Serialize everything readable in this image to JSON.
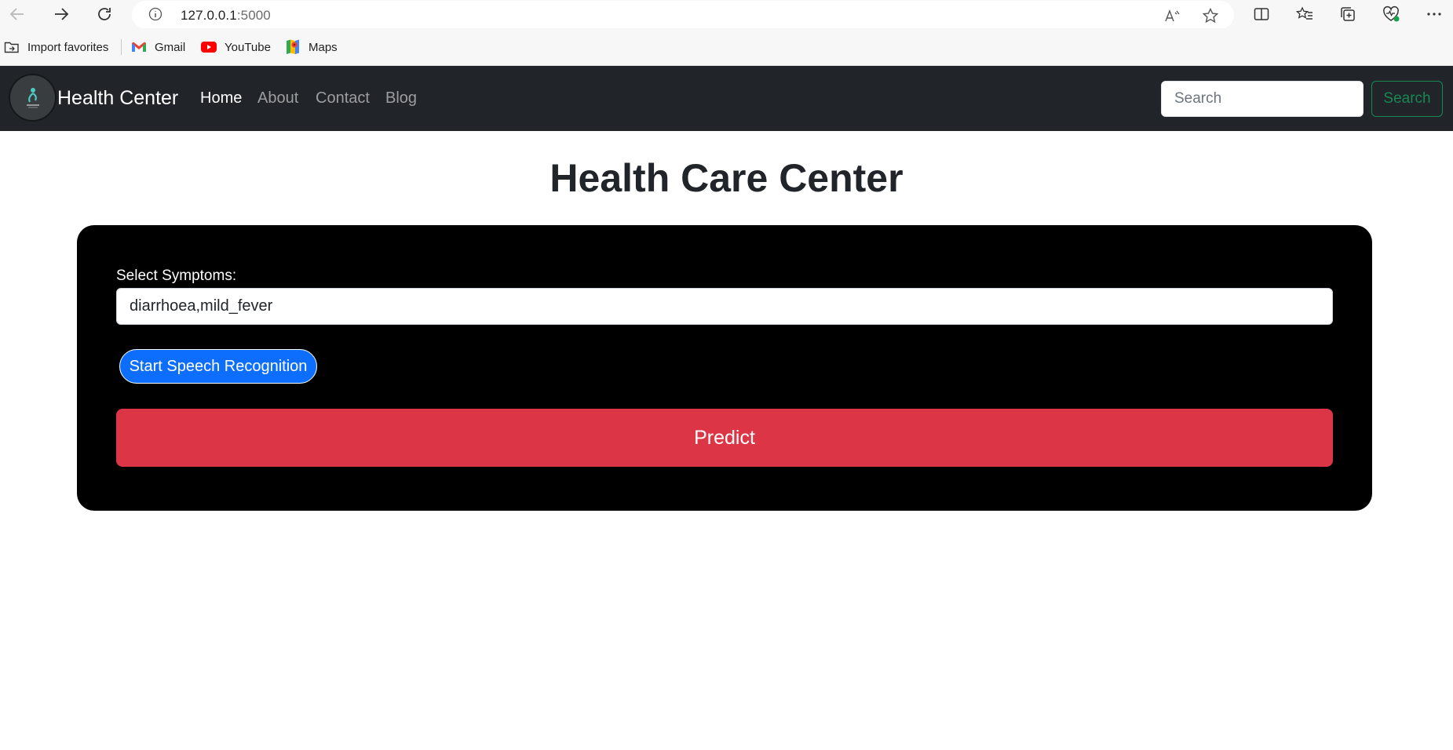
{
  "browser": {
    "url_host": "127.0.0.1",
    "url_port": ":5000",
    "icons": [
      "back-icon",
      "forward-icon",
      "refresh-icon",
      "site-info-icon",
      "read-aloud-icon",
      "favorite-star-icon",
      "split-screen-icon",
      "favorites-icon",
      "collections-icon",
      "browser-essentials-icon",
      "more-icon"
    ],
    "favorites": [
      {
        "label": "Import favorites",
        "icon": "import-favorites-icon"
      },
      {
        "label": "Gmail",
        "icon": "gmail-icon"
      },
      {
        "label": "YouTube",
        "icon": "youtube-icon"
      },
      {
        "label": "Maps",
        "icon": "maps-icon"
      }
    ]
  },
  "navbar": {
    "brand": "Health Center",
    "links": [
      "Home",
      "About",
      "Contact",
      "Blog"
    ],
    "active_link": "Home",
    "search_placeholder": "Search",
    "search_button": "Search"
  },
  "main": {
    "title": "Health Care Center",
    "symptoms_label": "Select Symptoms:",
    "symptoms_value": "diarrhoea,mild_fever",
    "speech_button": "Start Speech Recognition",
    "predict_button": "Predict"
  },
  "colors": {
    "navbar_bg": "#212529",
    "card_bg": "#000000",
    "primary": "#0d6efd",
    "danger": "#dc3545",
    "success": "#198754"
  }
}
